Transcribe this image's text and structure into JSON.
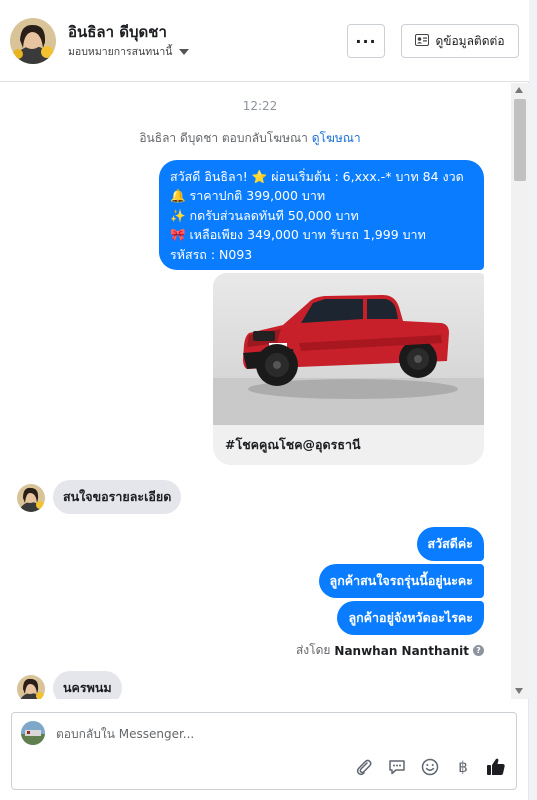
{
  "header": {
    "contact_name": "อินธิลา ดีบุดชา",
    "assign_label": "มอบหมายการสนทนานี้",
    "more_label": "···",
    "contact_button_label": "ดูข้อมูลติดต่อ"
  },
  "chat": {
    "time": "12:22",
    "reply_note_prefix": "อินธิลา ดีบุดชา ตอบกลับโฆษณา",
    "reply_note_link": "ดูโฆษณา",
    "promo_lines": [
      "สวัสดี อินธิลา! ⭐ ผ่อนเริ่มต้น : 6,xxx.-* บาท 84 งวด",
      "🔔 ราคาปกติ  399,000 บาท",
      "✨ กดรับส่วนลดทันที 50,000 บาท",
      "🎀 เหลือเพียง 349,000 บาท รับรถ 1,999 บาท",
      "รหัสรถ : N093"
    ],
    "card_caption": "#โชคคูณโชค@อุดรธานี",
    "incoming_1": "สนใจขอรายละเอียด",
    "outgoing": [
      "สวัสดีค่ะ",
      "ลูกค้าสนใจรถรุ่นนี้อยู่นะคะ",
      "ลูกค้าอยู่จังหวัดอะไรคะ"
    ],
    "sent_by_prefix": "ส่งโดย",
    "sent_by_name": "Nanwhan Nanthanit",
    "incoming_2": "นครพนม"
  },
  "composer": {
    "placeholder": "ตอบกลับใน Messenger..."
  },
  "colors": {
    "accent_blue": "#0a7cff",
    "incoming_grey": "#e4e6eb"
  },
  "icons": [
    "more-icon",
    "contact-card-icon",
    "attach-icon",
    "saved-reply-icon",
    "emoji-icon",
    "baht-icon",
    "like-icon"
  ]
}
